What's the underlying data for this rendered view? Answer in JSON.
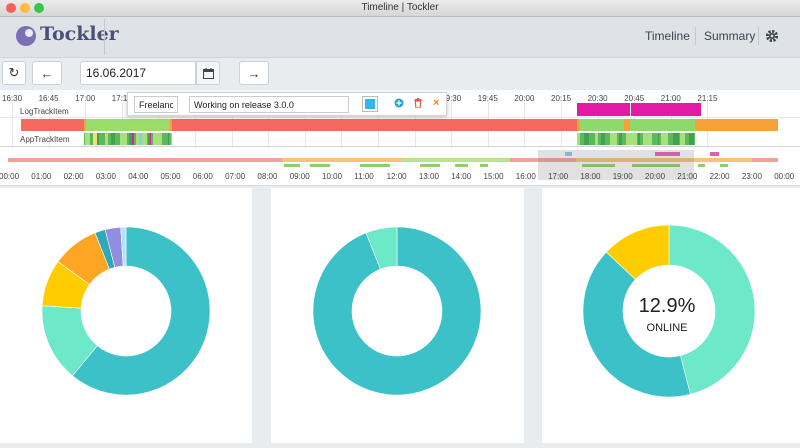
{
  "window": {
    "title": "Timeline | Tockler"
  },
  "header": {
    "logo": "Tockler",
    "nav": [
      "Timeline",
      "Summary"
    ],
    "settings_icon": "gear-icon"
  },
  "toolbar": {
    "refresh_icon": "refresh-icon",
    "prev_icon": "arrow-left-icon",
    "date": "16.06.2017",
    "calendar_icon": "calendar-icon",
    "next_icon": "arrow-right-icon"
  },
  "timeline": {
    "top_ticks": [
      "16:30",
      "16:45",
      "17:00",
      "17:15",
      "",
      "",
      "",
      "",
      "",
      "",
      "",
      "",
      "19:30",
      "19:45",
      "20:00",
      "20:15",
      "20:30",
      "20:45",
      "21:00",
      "21:15"
    ],
    "rows": [
      "LogTrackItem",
      "AppTrackItem"
    ],
    "bottom_ticks": [
      "00:00",
      "01:00",
      "02:00",
      "03:00",
      "04:00",
      "05:00",
      "06:00",
      "07:00",
      "08:00",
      "09:00",
      "10:00",
      "11:00",
      "12:00",
      "13:00",
      "14:00",
      "15:00",
      "16:00",
      "17:00",
      "18:00",
      "19:00",
      "20:00",
      "21:00",
      "22:00",
      "23:00",
      "00:00"
    ],
    "colors": {
      "status": "#f46a5e",
      "online": "#f6a03a",
      "app_green": "#5cb85c",
      "app_light": "#a6e07a",
      "log_pink": "#e21aa6"
    }
  },
  "popup": {
    "tag_value": "Freelance",
    "title_value": "Working on release 3.0.0",
    "color_swatch": "#30b8e8",
    "add_icon": "plus-circle-icon",
    "delete_icon": "trash-icon",
    "close_icon": "close-icon"
  },
  "charts": {
    "apps": {
      "colors": [
        "#3cc1c8",
        "#6de8c8",
        "#ffcc00",
        "#ffa524",
        "#2fa8b8",
        "#8f8ee0",
        "#b5e2ff"
      ],
      "values": [
        61,
        15,
        9,
        9,
        2,
        3,
        1
      ]
    },
    "titles": {
      "colors": [
        "#3cc1c8",
        "#6de8c8"
      ],
      "values": [
        94,
        6
      ]
    },
    "status": {
      "percent": "12.9%",
      "label": "ONLINE",
      "colors": [
        "#6de8c8",
        "#3cc1c8",
        "#ffcc00"
      ],
      "values": [
        46,
        41,
        13
      ]
    }
  }
}
